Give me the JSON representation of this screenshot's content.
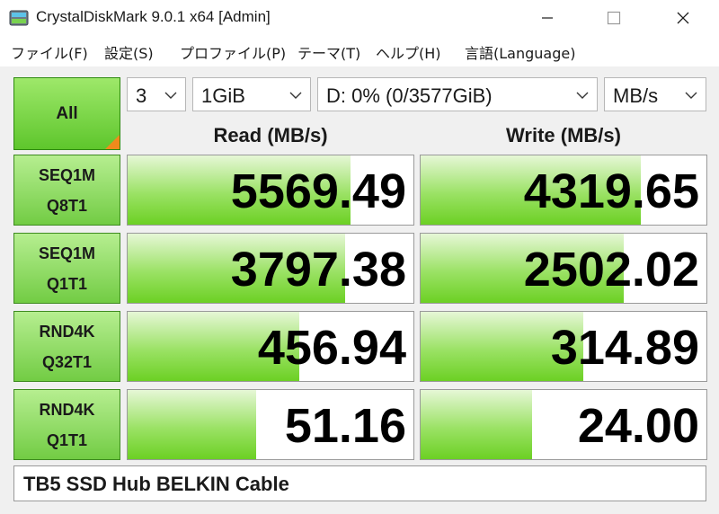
{
  "window": {
    "title": "CrystalDiskMark 9.0.1 x64 [Admin]"
  },
  "menu": [
    {
      "label": "ファイル(F)"
    },
    {
      "label": "設定(S)"
    },
    {
      "label": "プロファイル(P)"
    },
    {
      "label": "テーマ(T)"
    },
    {
      "label": "ヘルプ(H)"
    },
    {
      "label": "言語(Language)"
    }
  ],
  "controls": {
    "all_label": "All",
    "count": "3",
    "size": "1GiB",
    "drive": "D: 0% (0/3577GiB)",
    "unit": "MB/s"
  },
  "headers": {
    "read": "Read (MB/s)",
    "write": "Write (MB/s)"
  },
  "tests": [
    {
      "line1": "SEQ1M",
      "line2": "Q8T1",
      "read": "5569.49",
      "write": "4319.65",
      "read_level": 0.78,
      "write_level": 0.77
    },
    {
      "line1": "SEQ1M",
      "line2": "Q1T1",
      "read": "3797.38",
      "write": "2502.02",
      "read_level": 0.76,
      "write_level": 0.71
    },
    {
      "line1": "RND4K",
      "line2": "Q32T1",
      "read": "456.94",
      "write": "314.89",
      "read_level": 0.6,
      "write_level": 0.57
    },
    {
      "line1": "RND4K",
      "line2": "Q1T1",
      "read": "51.16",
      "write": "24.00",
      "read_level": 0.45,
      "write_level": 0.39
    }
  ],
  "comment": "TB5 SSD Hub BELKIN Cable",
  "colors": {
    "bar_green": "#6cd024",
    "button_green": "#72cc44",
    "corner_orange": "#f08a1c"
  },
  "icons": {
    "app": "disk-icon",
    "minimize": "minimize-icon",
    "maximize": "maximize-icon",
    "close": "close-icon",
    "dropdown": "chevron-down-icon"
  }
}
